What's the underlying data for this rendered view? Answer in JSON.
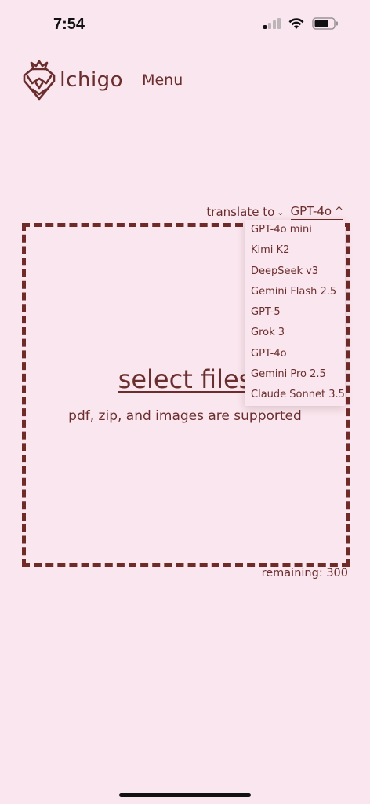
{
  "status": {
    "time": "7:54"
  },
  "header": {
    "brand": "Ichigo",
    "menu_label": "Menu"
  },
  "translate": {
    "label": "translate to",
    "label_caret": "⌄",
    "selected_model": "GPT-4o",
    "model_caret": "^"
  },
  "dropdown": {
    "options": [
      "GPT-4o mini",
      "Kimi K2",
      "DeepSeek v3",
      "Gemini Flash 2.5",
      "GPT-5",
      "Grok 3",
      "GPT-4o",
      "Gemini Pro 2.5",
      "Claude Sonnet 3.5"
    ]
  },
  "upload": {
    "select_label": "select files",
    "supported_text": "pdf, zip, and images are supported",
    "remaining_text": "remaining: 300"
  },
  "colors": {
    "background": "#fae6ee",
    "brand": "#6b2e2e"
  }
}
